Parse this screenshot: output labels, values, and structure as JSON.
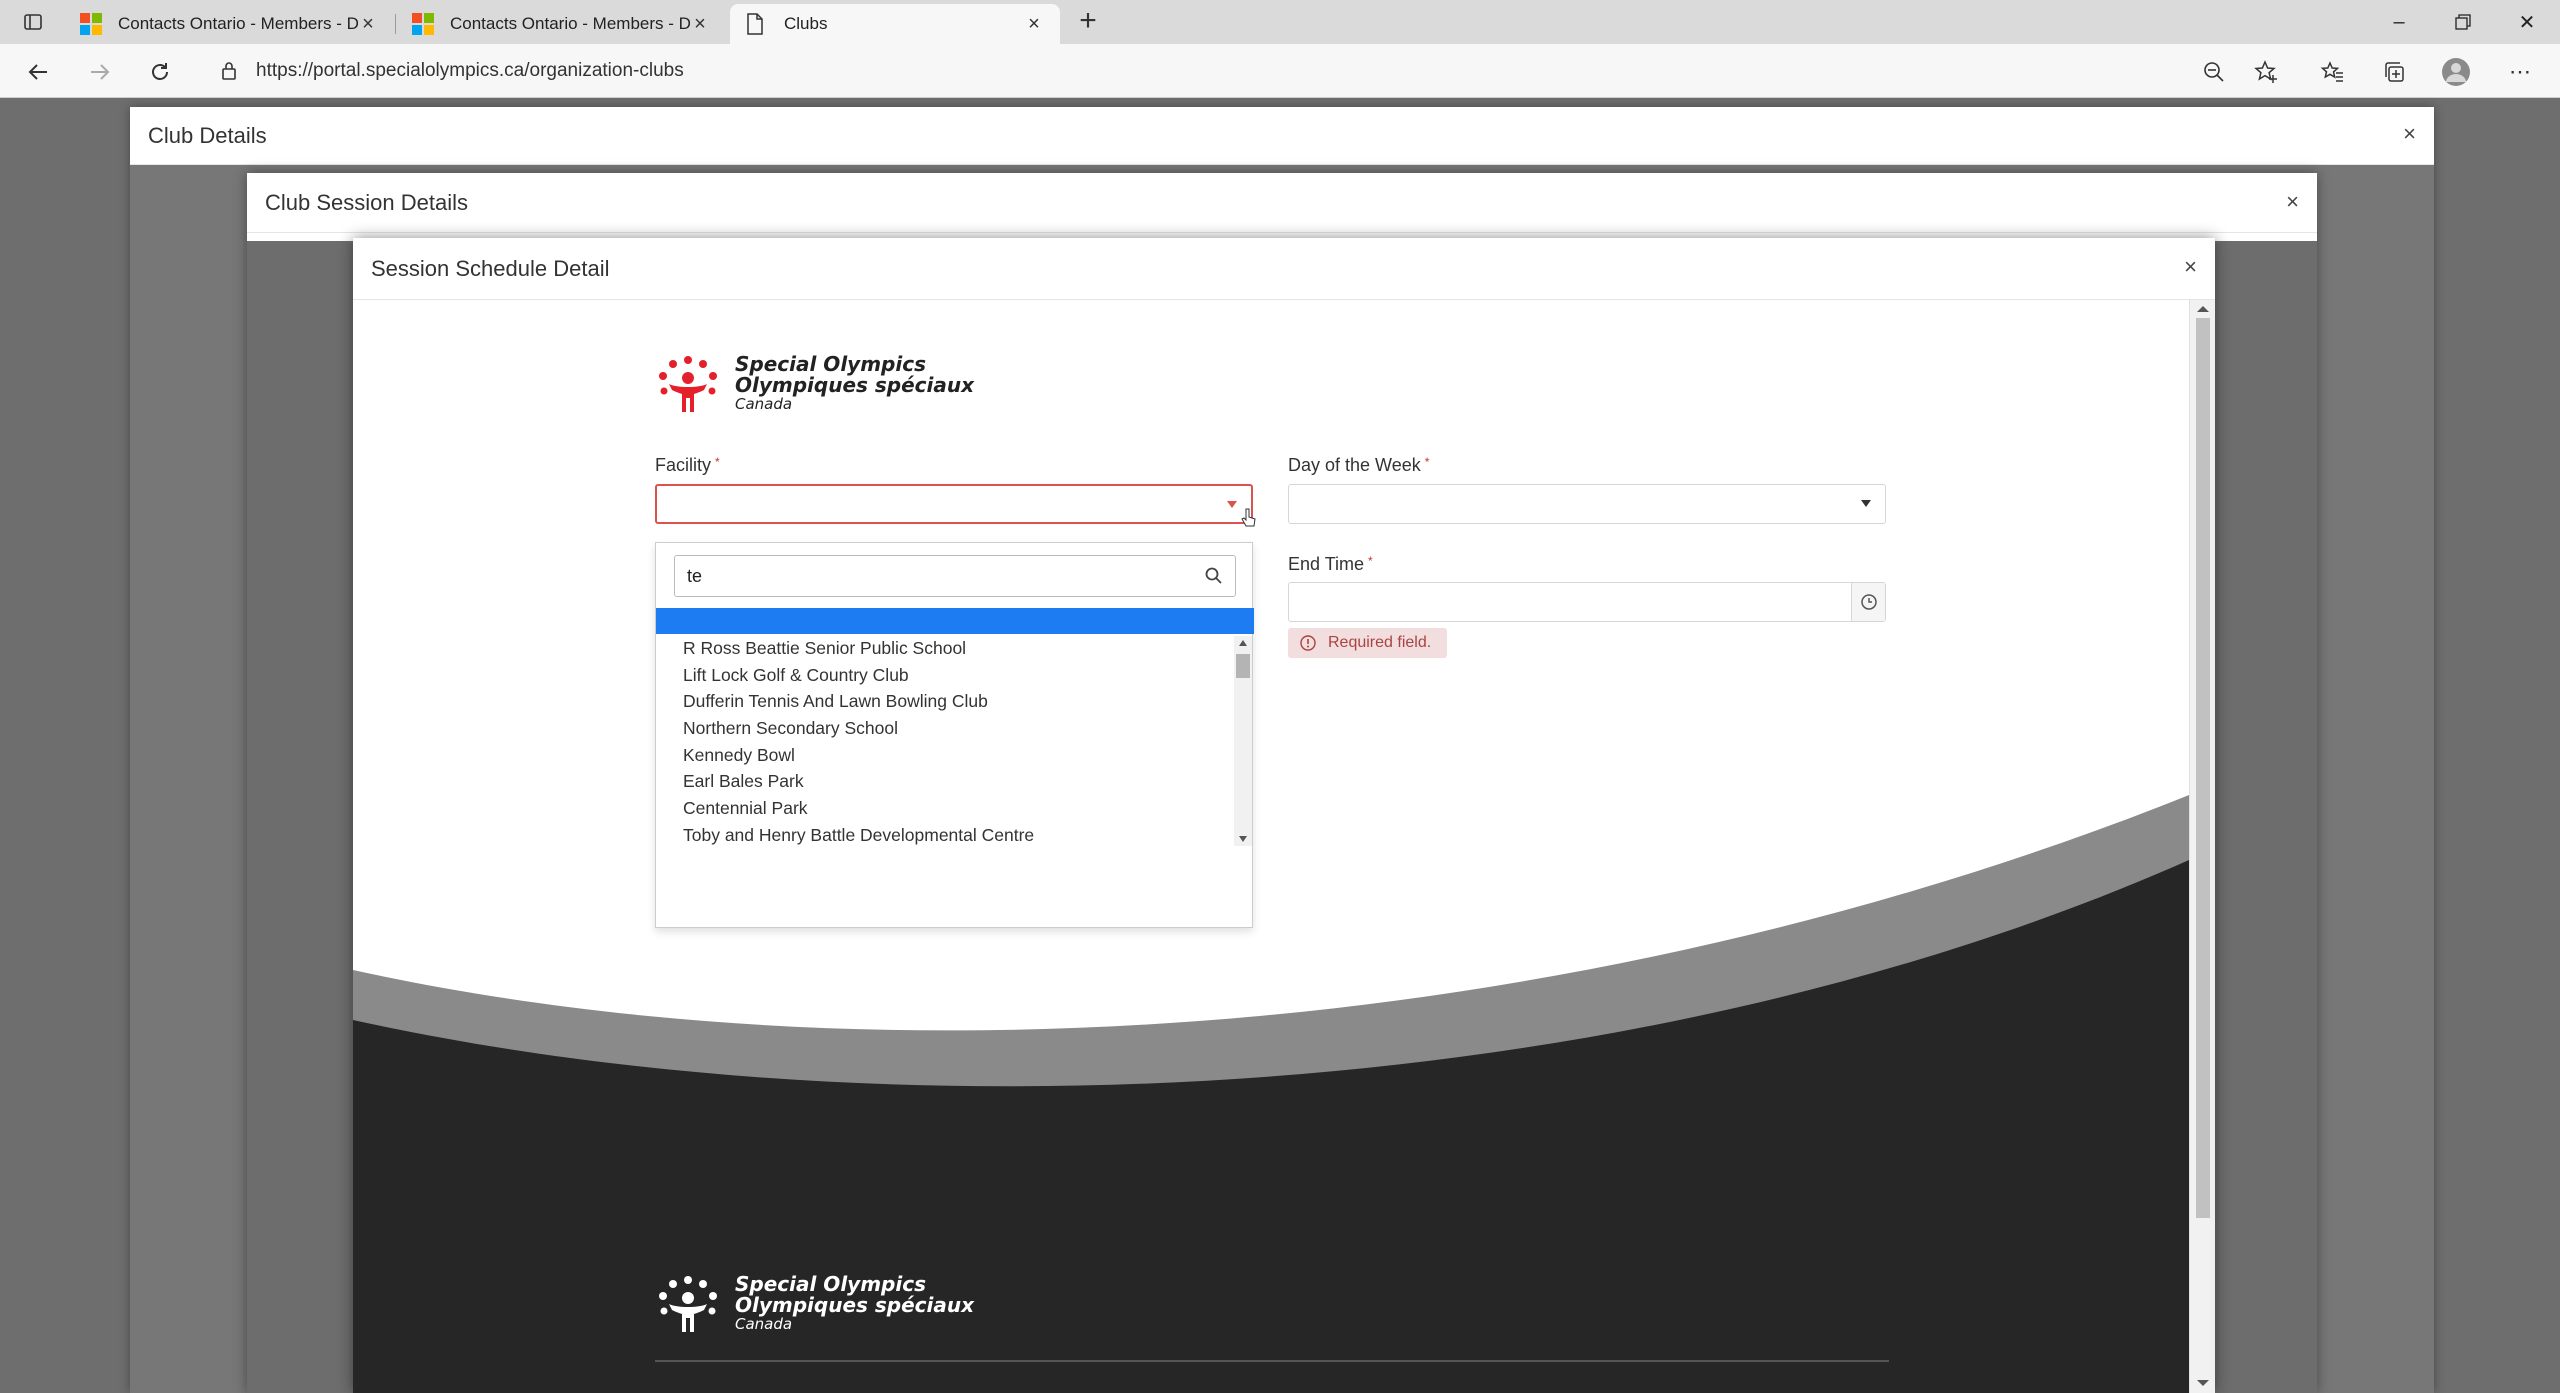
{
  "browser": {
    "tabs": [
      {
        "title": "Contacts Ontario - Members - D",
        "favicon": "microsoft-logo",
        "active": false
      },
      {
        "title": "Contacts Ontario - Members - D",
        "favicon": "microsoft-logo",
        "active": false
      },
      {
        "title": "Clubs",
        "favicon": "page-icon",
        "active": true
      }
    ],
    "url": "https://portal.specialolympics.ca/organization-clubs"
  },
  "club_details": {
    "title": "Club Details"
  },
  "club_session_details": {
    "title": "Club Session Details"
  },
  "session_schedule": {
    "title": "Session Schedule Detail",
    "logo": {
      "line1": "Special Olympics",
      "line2": "Olympiques spéciaux",
      "line3": "Canada"
    },
    "facility": {
      "label": "Facility",
      "required_mark": "*",
      "value": "",
      "search_value": "te",
      "options": [
        "R Ross Beattie Senior Public School",
        "Lift Lock Golf & Country Club",
        "Dufferin Tennis And Lawn Bowling Club",
        "Northern Secondary School",
        "Kennedy Bowl",
        "Earl Bales Park",
        "Centennial Park",
        "Toby and Henry Battle Developmental Centre"
      ]
    },
    "day_of_week": {
      "label": "Day of the Week",
      "required_mark": "*",
      "value": ""
    },
    "end_time": {
      "label": "End Time",
      "required_mark": "*",
      "value": "",
      "error": "Required field."
    }
  },
  "colors": {
    "accent_blue": "#1d7cf2",
    "error_red": "#d9534f",
    "brand_red": "#e4202a"
  }
}
